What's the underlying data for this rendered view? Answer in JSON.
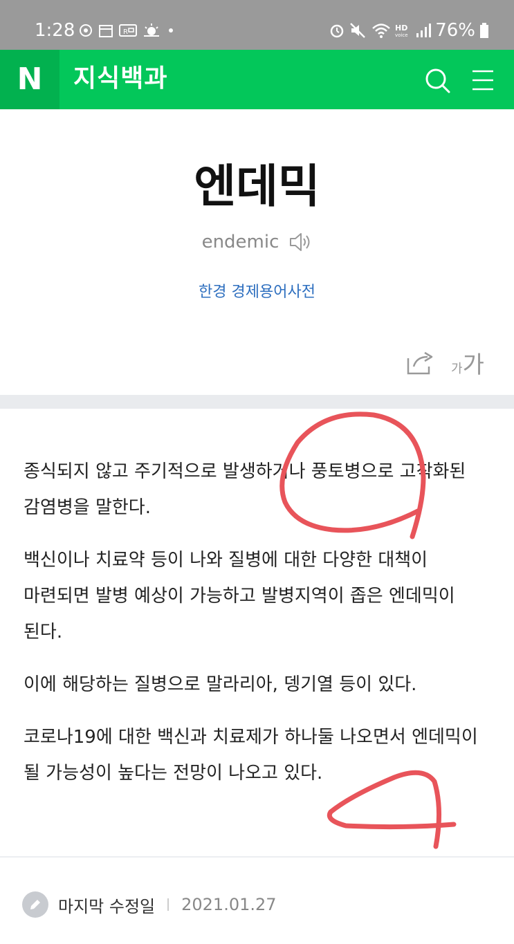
{
  "status_bar": {
    "time": "1:28",
    "battery": "76%",
    "icons": [
      "dnd-icon",
      "calendar-icon",
      "rcs-icon",
      "weather-icon",
      "alarm-icon",
      "mute-icon",
      "wifi-icon",
      "hd-voice-icon",
      "signal-icon",
      "battery-icon"
    ]
  },
  "header": {
    "logo": "N",
    "title": "지식백과",
    "brand_color": "#03c75a"
  },
  "entry": {
    "title": "엔데믹",
    "pronunciation": "endemic",
    "source": "한경 경제용어사전"
  },
  "tools": {
    "font_small": "가",
    "font_big": "가"
  },
  "body": {
    "paragraphs": [
      "종식되지 않고 주기적으로 발생하거나 풍토병으로 고착화된 감염병을 말한다.",
      "백신이나 치료약 등이 나와 질병에 대한 다양한 대책이 마련되면 발병 예상이 가능하고 발병지역이 좁은 엔데믹이 된다.",
      "이에 해당하는 질병으로 말라리아, 뎅기열 등이 있다.",
      "코로나19에 대한 백신과 치료제가 하나둘 나오면서 엔데믹이 될 가능성이 높다는 전망이 나오고 있다."
    ]
  },
  "footer": {
    "label": "마지막 수정일",
    "date": "2021.01.27"
  },
  "annotation_color": "#e8545a"
}
